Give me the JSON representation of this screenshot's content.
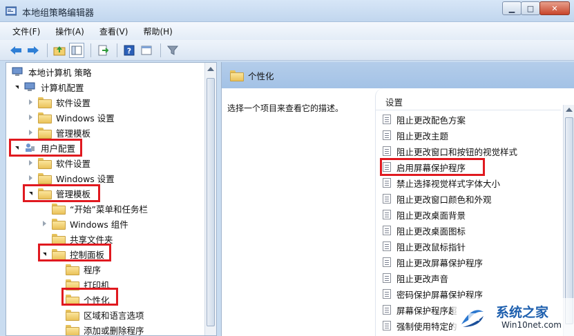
{
  "window": {
    "title": "本地组策略编辑器"
  },
  "menu": [
    "文件(F)",
    "操作(A)",
    "查看(V)",
    "帮助(H)"
  ],
  "toolbar": [
    "back-icon",
    "forward-icon",
    "up-folder-icon",
    "show-hide-tree-icon",
    "export-icon",
    "help-icon",
    "properties-icon",
    "filter-icon"
  ],
  "tree": {
    "root": "本地计算机 策略",
    "items": [
      "计算机配置",
      "软件设置",
      "Windows 设置",
      "管理模板",
      "用户配置",
      "软件设置",
      "Windows 设置",
      "管理模板",
      "“开始”菜单和任务栏",
      "Windows 组件",
      "共享文件夹",
      "控制面板",
      "程序",
      "打印机",
      "个性化",
      "区域和语言选项",
      "添加或删除程序"
    ]
  },
  "right": {
    "header": "个性化",
    "description": "选择一个项目来查看它的描述。",
    "column_header": "设置",
    "settings": [
      "阻止更改配色方案",
      "阻止更改主题",
      "阻止更改窗口和按钮的视觉样式",
      "启用屏幕保护程序",
      "禁止选择视觉样式字体大小",
      "阻止更改窗口颜色和外观",
      "阻止更改桌面背景",
      "阻止更改桌面图标",
      "阻止更改鼠标指针",
      "阻止更改屏幕保护程序",
      "阻止更改声音",
      "密码保护屏幕保护程序",
      "屏幕保护程序超",
      "强制使用特定的"
    ]
  },
  "watermark": {
    "title": "系统之家",
    "url": "Win10net.com"
  }
}
